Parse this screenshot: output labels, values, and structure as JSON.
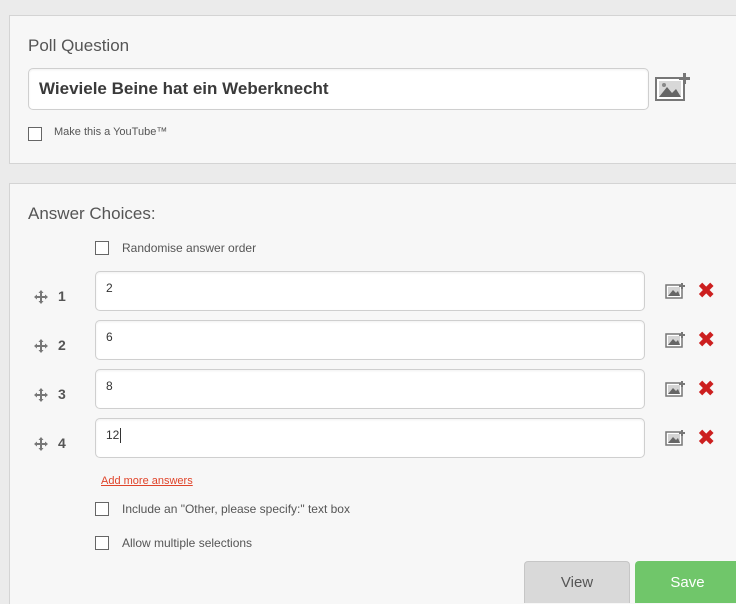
{
  "poll": {
    "section_title": "Poll Question",
    "question_value": "Wieviele Beine hat ein Weberknecht",
    "youtube_label": "Make this a YouTube™"
  },
  "answers": {
    "section_title": "Answer Choices:",
    "randomise_label": "Randomise answer order",
    "items": [
      {
        "number": "1",
        "value": "2"
      },
      {
        "number": "2",
        "value": "6"
      },
      {
        "number": "3",
        "value": "8"
      },
      {
        "number": "4",
        "value": "12"
      }
    ],
    "add_more_label": "Add more answers",
    "other_label": "Include an \"Other, please specify:\" text box",
    "multiple_label": "Allow multiple selections"
  },
  "buttons": {
    "view_label": "View",
    "save_label": "Save"
  },
  "icons": {
    "drag": "move-icon",
    "image": "image-icon",
    "remove": "remove-icon"
  },
  "colors": {
    "save": "#70c66a",
    "remove": "#cc1f1f",
    "link": "#e0442a"
  }
}
